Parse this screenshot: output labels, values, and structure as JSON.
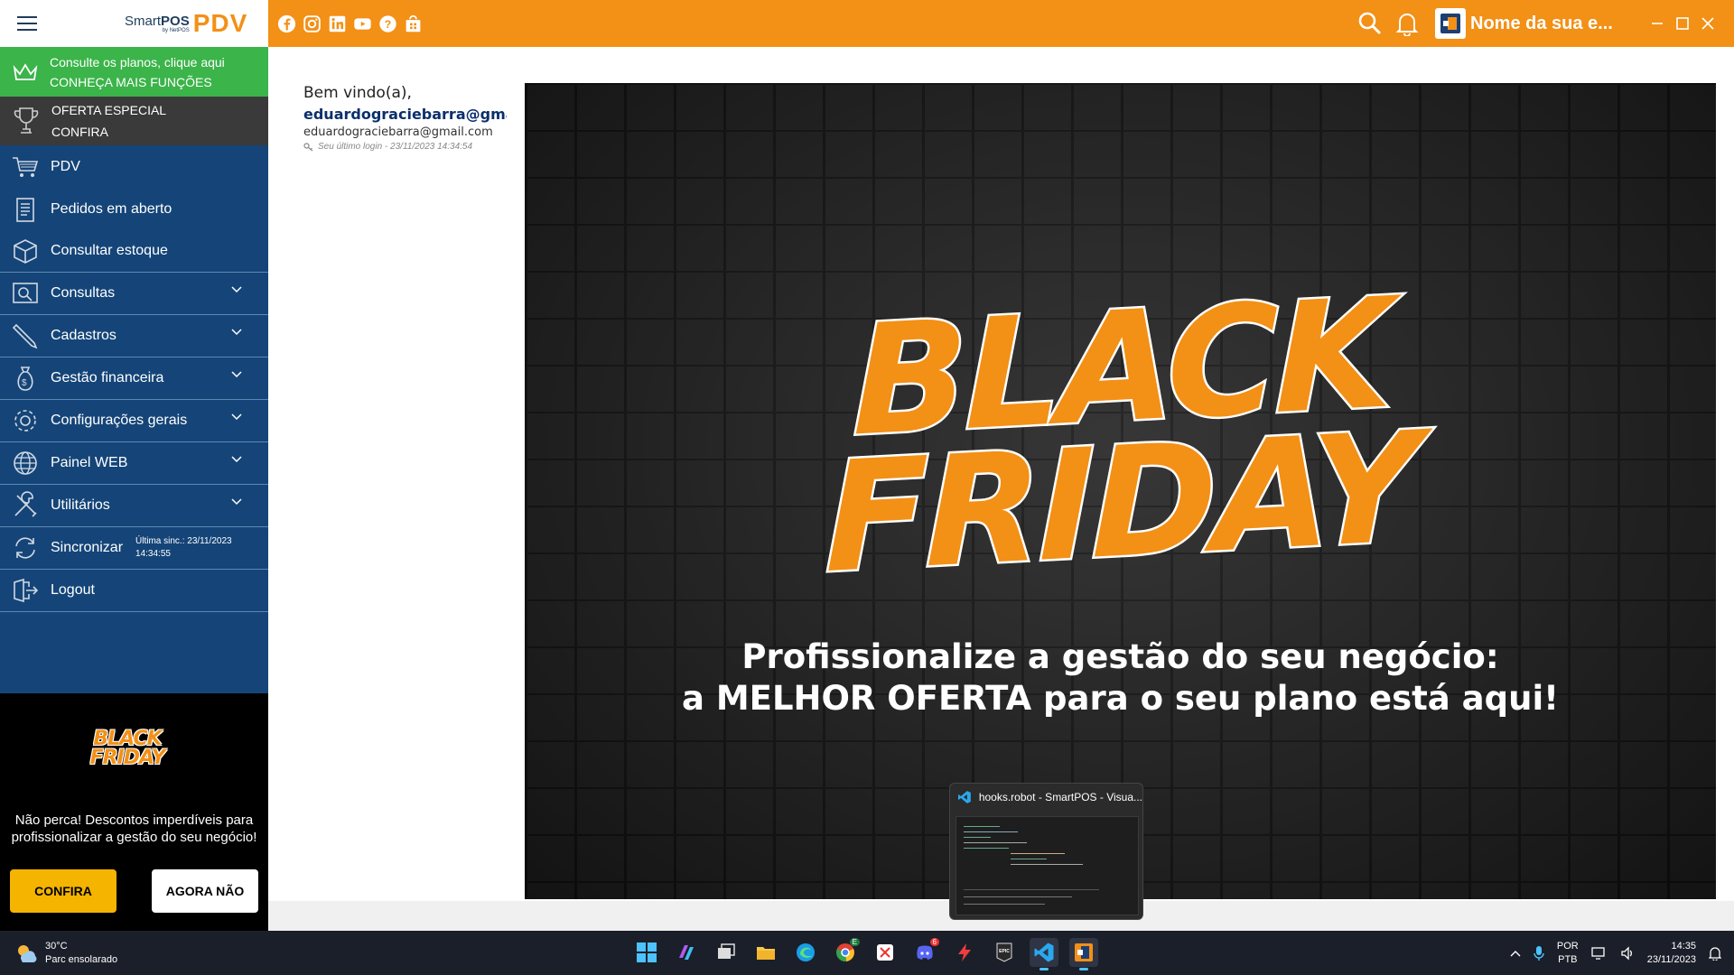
{
  "brand": {
    "smart": "Smart",
    "pos": "POS",
    "by": "by NetPOS",
    "pdv": "PDV"
  },
  "promo_green": {
    "line1": "Consulte os planos, clique aqui",
    "line2": "CONHEÇA MAIS FUNÇÕES"
  },
  "promo_dark": {
    "line1": "OFERTA ESPECIAL",
    "line2": "CONFIRA"
  },
  "menu": {
    "items": [
      {
        "label": "PDV"
      },
      {
        "label": "Pedidos em aberto"
      },
      {
        "label": "Consultar estoque"
      },
      {
        "label": "Consultas"
      },
      {
        "label": "Cadastros"
      },
      {
        "label": "Gestão financeira"
      },
      {
        "label": "Configurações gerais"
      },
      {
        "label": "Painel WEB"
      },
      {
        "label": "Utilitários"
      },
      {
        "label": "Sincronizar"
      },
      {
        "label": "Logout"
      }
    ],
    "sync_info_line1": "Última sinc.: 23/11/2023",
    "sync_info_line2": "14:34:55"
  },
  "side_promo": {
    "logo_line1": "BLACK",
    "logo_line2": "FRIDAY",
    "text_line1": "Não perca! Descontos imperdíveis para",
    "text_line2": "profissionalizar a gestão do seu negócio!",
    "confirm_label": "CONFIRA",
    "dismiss_label": "AGORA NÃO"
  },
  "topbar": {
    "company_name": "Nome da sua e...",
    "social_icons": [
      "facebook-icon",
      "instagram-icon",
      "linkedin-icon",
      "youtube-icon",
      "help-icon",
      "store-icon"
    ]
  },
  "welcome": {
    "greeting": "Bem vindo(a),",
    "name": "eduardograciebarra@gmai",
    "email": "eduardograciebarra@gmail.com",
    "last_login": "Seu último login - 23/11/2023 14:34:54"
  },
  "banner": {
    "title_line1": "BLACK",
    "title_line2": "FRIDAY",
    "line1": "Profissionalize a gestão do seu negócio:",
    "line2_pre": "a",
    "line2_bold": "MELHOR OFERTA",
    "line2_post": "para o seu plano está aqui!"
  },
  "thumbnail": {
    "title": "hooks.robot - SmartPOS - Visua..."
  },
  "taskbar": {
    "weather_temp": "30°C",
    "weather_desc": "Parc ensolarado",
    "lang1": "POR",
    "lang2": "PTB",
    "time": "14:35",
    "date": "23/11/2023",
    "chrome_badge": "E",
    "discord_badge": "6"
  },
  "colors": {
    "orange": "#f39016",
    "sidebar": "#154578",
    "green": "#3bb44a"
  }
}
